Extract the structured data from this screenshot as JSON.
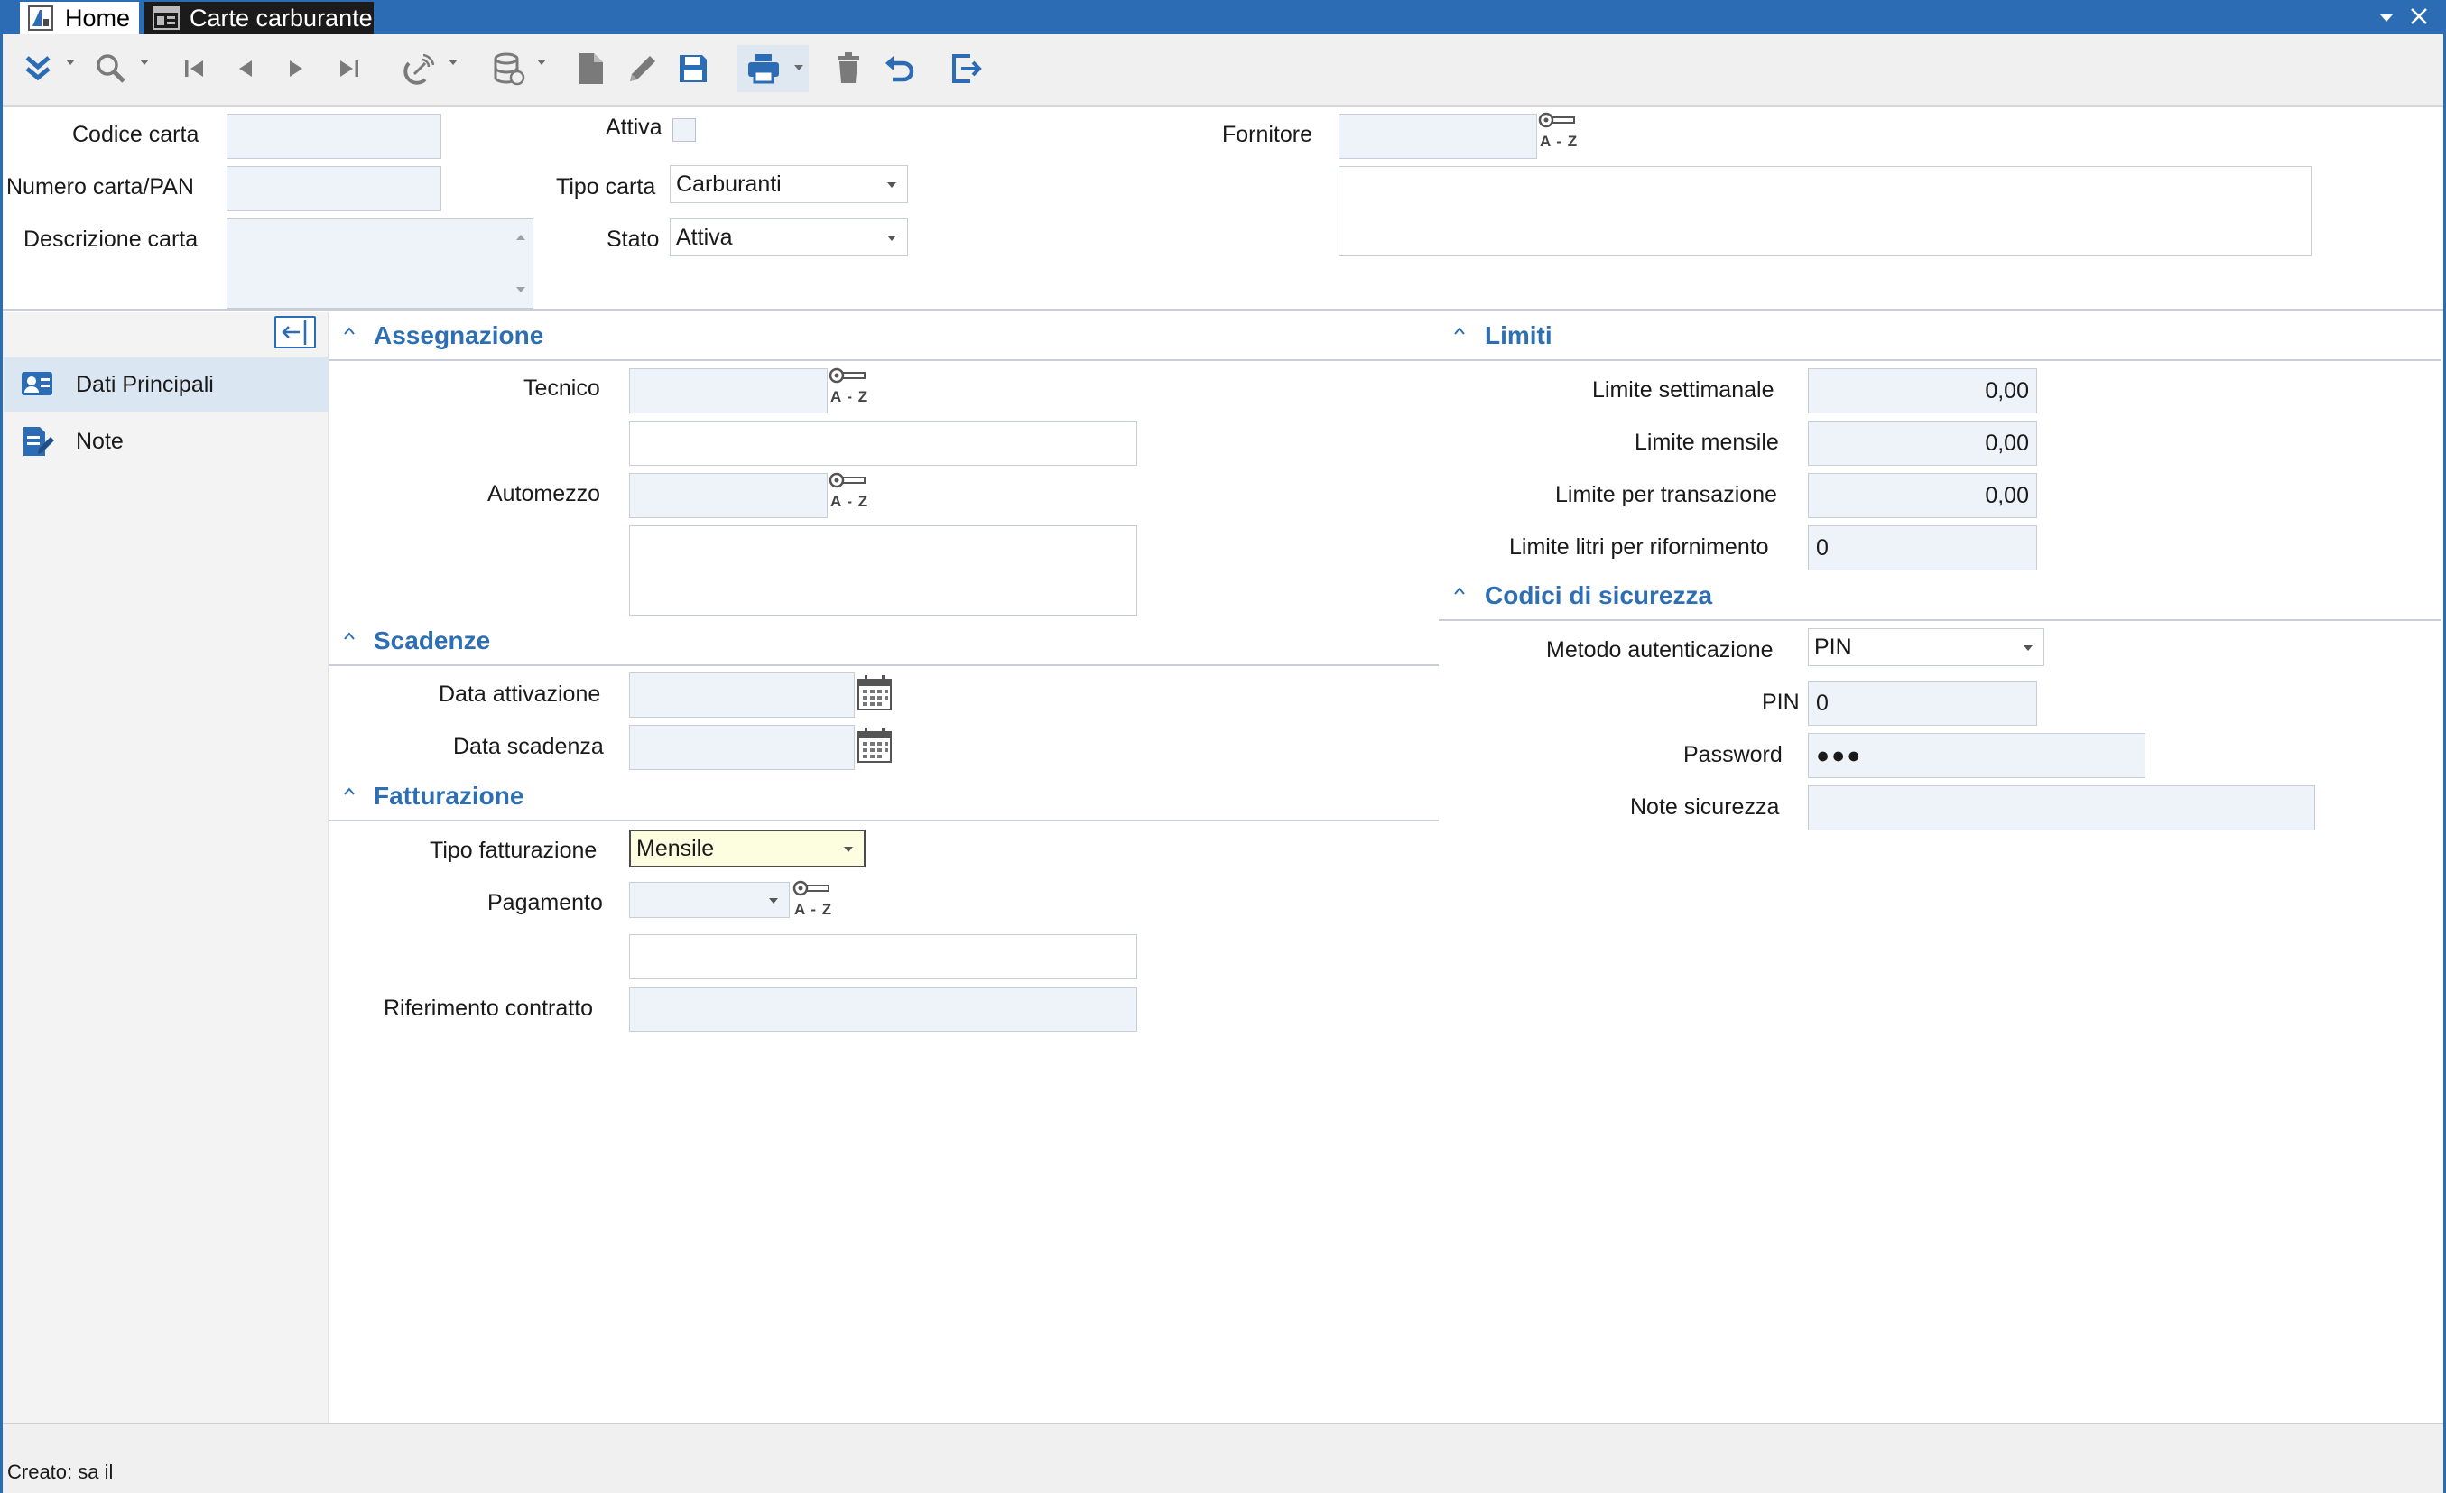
{
  "titlebar": {
    "tab_home": "Home",
    "tab_active": "Carte carburante",
    "colors": {
      "bar": "#2b6cb5",
      "accent": "#2e6fb3"
    }
  },
  "toolbar": {
    "icons": [
      "expand-icon",
      "search-icon",
      "first-record-icon",
      "previous-record-icon",
      "next-record-icon",
      "last-record-icon",
      "satellite-icon",
      "database-icon",
      "new-document-icon",
      "edit-icon",
      "save-icon",
      "print-icon",
      "delete-icon",
      "undo-icon",
      "exit-icon"
    ]
  },
  "header": {
    "codice_carta_label": "Codice carta",
    "codice_carta_value": "",
    "numero_carta_label": "Numero carta/PAN",
    "numero_carta_value": "",
    "descrizione_label": "Descrizione carta",
    "descrizione_value": "",
    "attiva_label": "Attiva",
    "attiva_checked": false,
    "tipo_carta_label": "Tipo carta",
    "tipo_carta_value": "Carburanti",
    "stato_label": "Stato",
    "stato_value": "Attiva",
    "fornitore_label": "Fornitore",
    "fornitore_value": "",
    "fornitore_desc": ""
  },
  "lookup_text": "A - Z",
  "sidebar": {
    "items": [
      {
        "label": "Dati Principali",
        "active": true
      },
      {
        "label": "Note",
        "active": false
      }
    ]
  },
  "assegnazione": {
    "title": "Assegnazione",
    "tecnico_label": "Tecnico",
    "tecnico_value": "",
    "tecnico_desc": "",
    "automezzo_label": "Automezzo",
    "automezzo_value": "",
    "automezzo_desc": ""
  },
  "scadenze": {
    "title": "Scadenze",
    "attivazione_label": "Data attivazione",
    "attivazione_value": "",
    "scadenza_label": "Data scadenza",
    "scadenza_value": ""
  },
  "fatturazione": {
    "title": "Fatturazione",
    "tipo_label": "Tipo fatturazione",
    "tipo_value": "Mensile",
    "pagamento_label": "Pagamento",
    "pagamento_value": "",
    "pagamento_desc": "",
    "riferimento_label": "Riferimento contratto",
    "riferimento_value": ""
  },
  "limiti": {
    "title": "Limiti",
    "settimanale_label": "Limite settimanale",
    "settimanale_value": "0,00",
    "mensile_label": "Limite mensile",
    "mensile_value": "0,00",
    "transazione_label": "Limite per transazione",
    "transazione_value": "0,00",
    "litri_label": "Limite litri per rifornimento",
    "litri_value": "0"
  },
  "sicurezza": {
    "title": "Codici di sicurezza",
    "metodo_label": "Metodo autenticazione",
    "metodo_value": "PIN",
    "pin_label": "PIN",
    "pin_value": "0",
    "password_label": "Password",
    "password_value": "●●●",
    "note_label": "Note sicurezza",
    "note_value": ""
  },
  "status": {
    "created": "Creato: sa il"
  }
}
